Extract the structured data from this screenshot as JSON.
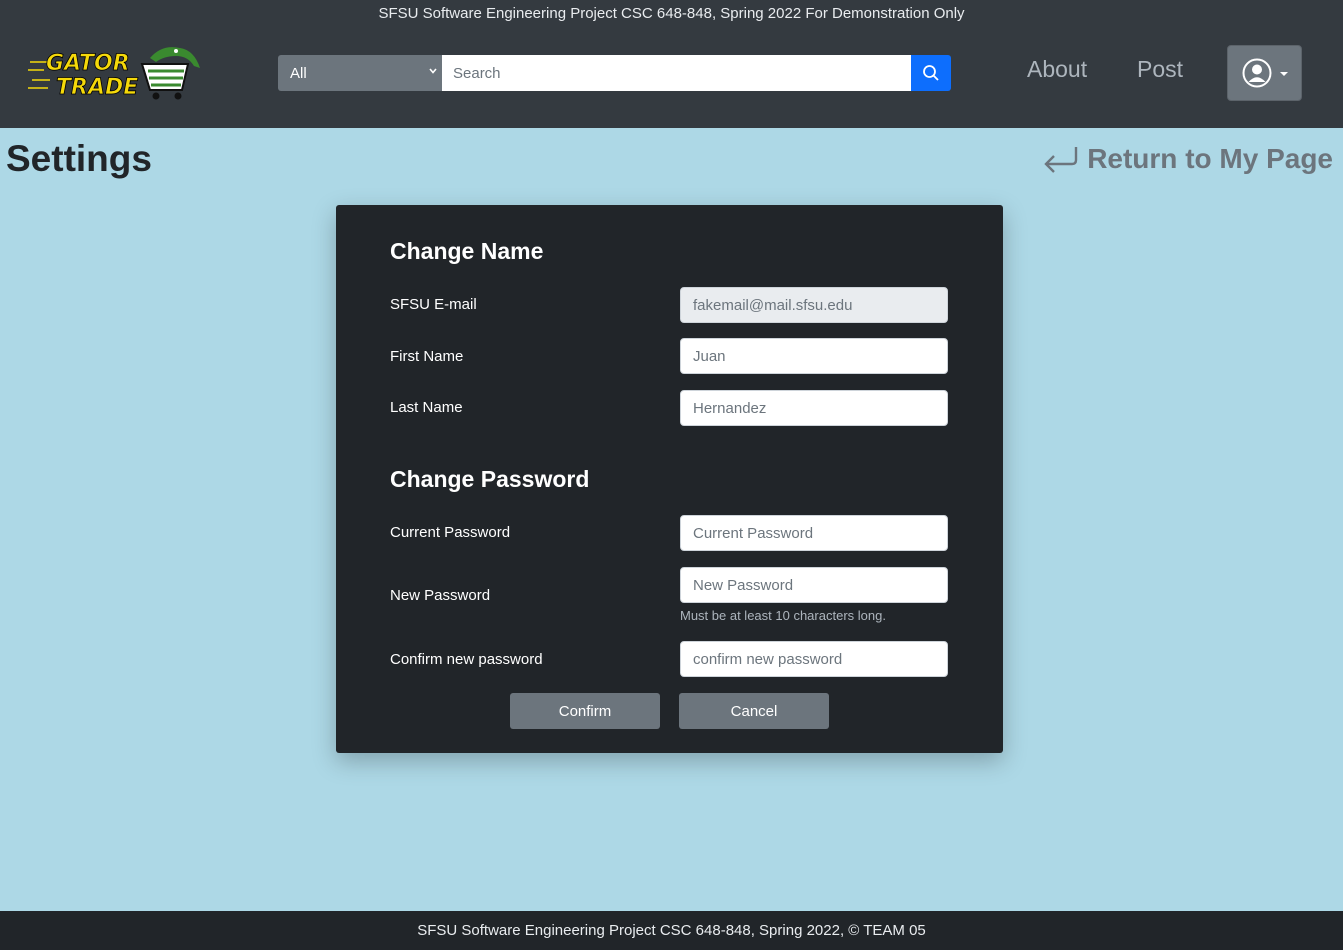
{
  "header": {
    "banner": "SFSU Software Engineering Project CSC 648-848, Spring 2022 For Demonstration Only",
    "logo_text_top": "GATOR",
    "logo_text_bottom": "TRADE",
    "category_selected": "All",
    "search_placeholder": "Search",
    "nav": {
      "about": "About",
      "post": "Post"
    },
    "icons": {
      "search": "search-icon",
      "user": "user-circle-icon",
      "caret": "caret-down-icon"
    }
  },
  "page": {
    "title": "Settings",
    "return_link": "Return to My Page"
  },
  "form": {
    "change_name_title": "Change Name",
    "email_label": "SFSU E-mail",
    "email_value": "fakemail@mail.sfsu.edu",
    "first_name_label": "First Name",
    "first_name_value": "Juan",
    "last_name_label": "Last Name",
    "last_name_value": "Hernandez",
    "change_password_title": "Change Password",
    "current_password_label": "Current Password",
    "current_password_placeholder": "Current Password",
    "new_password_label": "New Password",
    "new_password_placeholder": "New Password",
    "new_password_help": "Must be at least 10 characters long.",
    "confirm_password_label": "Confirm new password",
    "confirm_password_placeholder": "confirm new password",
    "confirm_button": "Confirm",
    "cancel_button": "Cancel"
  },
  "footer": {
    "text": "SFSU Software Engineering Project CSC 648-848, Spring 2022, © TEAM 05"
  },
  "colors": {
    "page_bg": "#add8e6",
    "header_bg": "#343a40",
    "card_bg": "#212529",
    "accent_blue": "#0d6efd",
    "logo_yellow": "#f5d90a",
    "logo_green": "#3a8a2f"
  }
}
